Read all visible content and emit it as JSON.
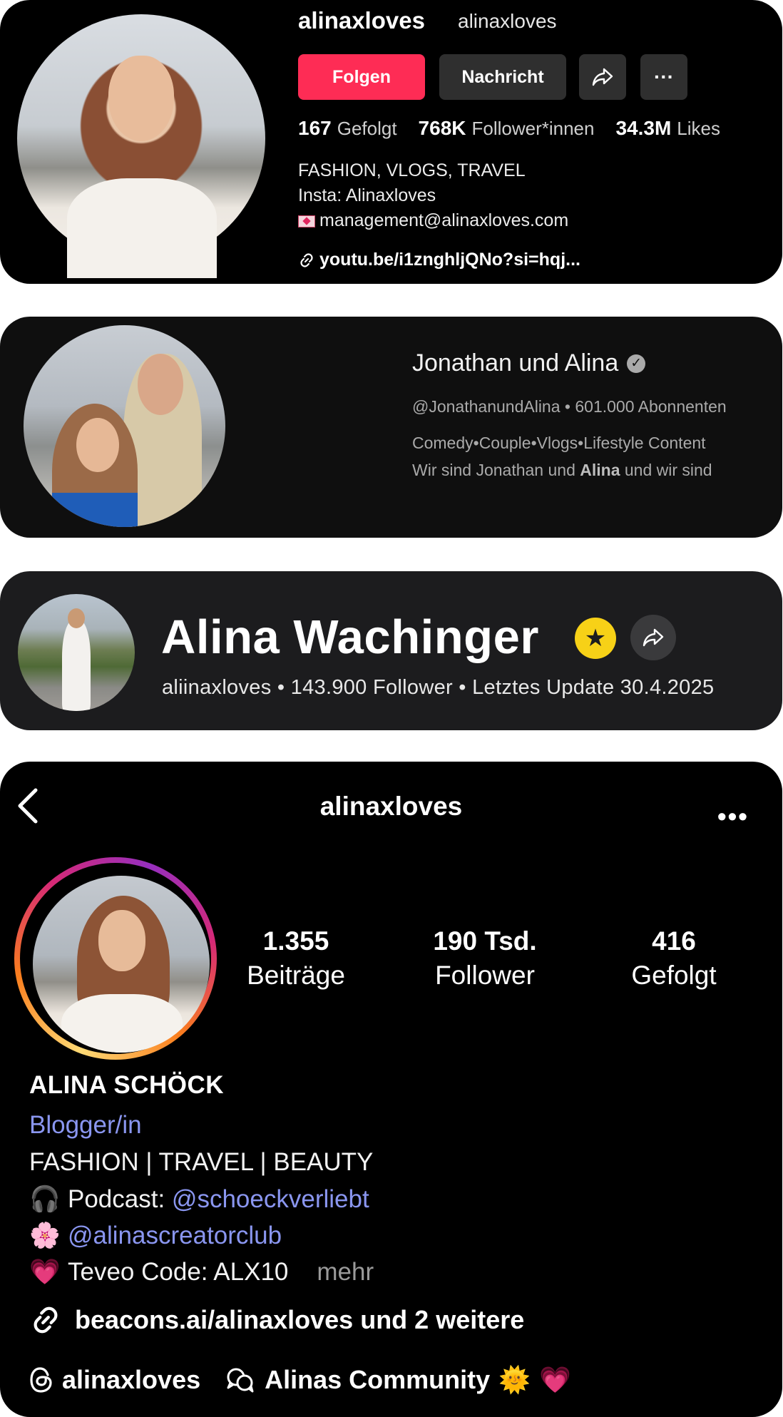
{
  "tiktok": {
    "name": "alinaxloves",
    "handle": "alinaxloves",
    "follow_label": "Folgen",
    "message_label": "Nachricht",
    "more_label": "···",
    "stats": [
      {
        "value": "167",
        "label": "Gefolgt"
      },
      {
        "value": "768K",
        "label": "Follower*innen"
      },
      {
        "value": "34.3M",
        "label": "Likes"
      }
    ],
    "bio": [
      "FASHION, VLOGS, TRAVEL",
      "Insta: Alinaxloves",
      "management@alinaxloves.com"
    ],
    "link": "youtu.be/i1znghljQNo?si=hqj..."
  },
  "youtube": {
    "channel_name": "Jonathan und Alina",
    "handle": "@JonathanundAlina",
    "separator": "•",
    "subscribers": "601.000 Abonnenten",
    "desc_line1": "Comedy•Couple•Vlogs•Lifestyle Content",
    "desc_line2_a": "Wir sind Jonathan und ",
    "desc_line2_b": "Alina",
    "desc_line2_c": " und wir sind"
  },
  "profile3": {
    "title": "Alina Wachinger",
    "meta": "aliinaxloves • 143.900 Follower • Letztes Update 30.4.2025"
  },
  "instagram": {
    "header_username": "alinaxloves",
    "stats": [
      {
        "value": "1.355",
        "label": "Beiträge"
      },
      {
        "value": "190 Tsd.",
        "label": "Follower"
      },
      {
        "value": "416",
        "label": "Gefolgt"
      }
    ],
    "full_name": "ALINA SCHÖCK",
    "category": "Blogger/in",
    "bio_line1": "FASHION | TRAVEL | BEAUTY",
    "podcast_label": "Podcast: ",
    "podcast_handle": "@schoeckverliebt",
    "club_handle": "@alinascreatorclub",
    "code_text": "Teveo Code: ALX10",
    "more_label": "mehr",
    "link_text": "beacons.ai/alinaxloves und 2 weitere",
    "threads_handle": "alinaxloves",
    "community_label": "Alinas Community"
  },
  "colors": {
    "tiktok_red": "#fe2c55",
    "instagram_link_blue": "#8a96f0",
    "star_yellow": "#f7d117"
  }
}
